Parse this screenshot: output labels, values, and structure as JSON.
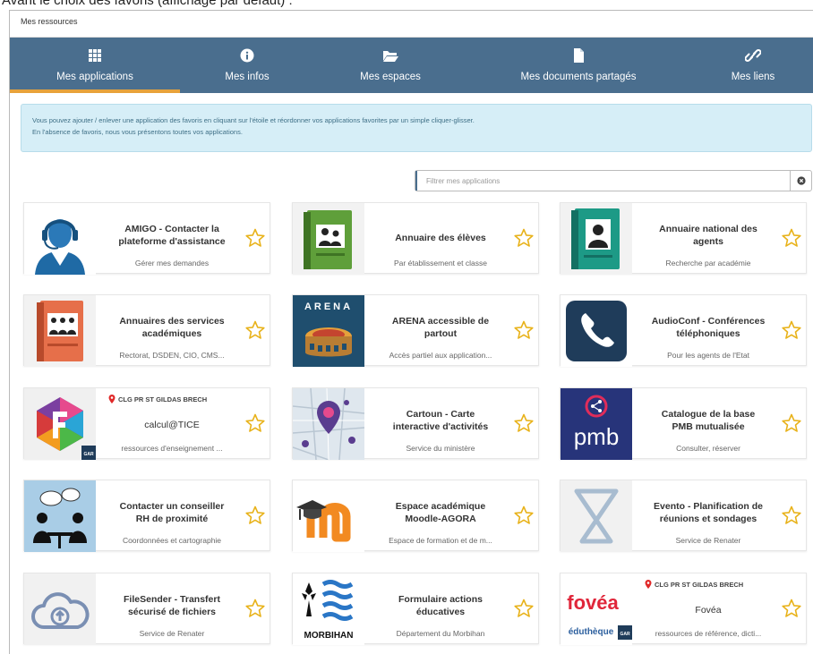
{
  "caption": "Avant le choix des favoris (affichage par défaut) :",
  "panel": {
    "title": "Mes ressources"
  },
  "tabs": [
    {
      "label": "Mes applications",
      "icon": "grid-icon",
      "active": true
    },
    {
      "label": "Mes infos",
      "icon": "info-icon",
      "active": false
    },
    {
      "label": "Mes espaces",
      "icon": "folder-open-icon",
      "active": false
    },
    {
      "label": "Mes documents partagés",
      "icon": "document-icon",
      "active": false
    },
    {
      "label": "Mes liens",
      "icon": "link-icon",
      "active": false
    }
  ],
  "info": {
    "line1": "Vous pouvez ajouter / enlever une application des favoris en cliquant sur l'étoile et réordonner vos applications favorites par un simple cliquer-glisser.",
    "line2": "En l'absence de favoris, nous vous présentons toutes vos applications."
  },
  "filter": {
    "placeholder": "Filtrer mes applications",
    "value": ""
  },
  "colors": {
    "tabbar": "#4a6e8e",
    "tab_active_underline": "#e8a23a",
    "info_bg": "#d6eef7",
    "star": "#e8b21a"
  },
  "apps": [
    {
      "title_l1": "AMIGO - Contacter la",
      "title_l2": "plateforme d'assistance",
      "desc": "Gérer mes demandes",
      "thumb": "headset-agent-icon"
    },
    {
      "title_l1": "Annuaire des élèves",
      "title_l2": "",
      "desc": "Par établissement et classe",
      "thumb": "green-directory-book-icon"
    },
    {
      "title_l1": "Annuaire national des",
      "title_l2": "agents",
      "desc": "Recherche par académie",
      "thumb": "teal-directory-book-icon"
    },
    {
      "title_l1": "Annuaires des services",
      "title_l2": "académiques",
      "desc": "Rectorat, DSDEN, CIO, CMS...",
      "thumb": "orange-directory-book-icon"
    },
    {
      "title_l1": "ARENA accessible de",
      "title_l2": "partout",
      "desc": "Accès partiel aux application...",
      "thumb": "arena-colosseum-icon",
      "thumb_text": "ARENA"
    },
    {
      "title_l1": "AudioConf - Conférences",
      "title_l2": "téléphoniques",
      "desc": "Pour les agents de l'Etat",
      "thumb": "phone-icon"
    },
    {
      "title_l1": "calcul@TICE",
      "title_l2": "",
      "desc": "ressources d'enseignement ...",
      "thumb": "calcul-tice-logo",
      "location": "CLG PR ST GILDAS BRECH",
      "thumb_badge": "GAR"
    },
    {
      "title_l1": "Cartoun - Carte",
      "title_l2": "interactive d'activités",
      "desc": "Service du ministère",
      "thumb": "map-pin-icon"
    },
    {
      "title_l1": "Catalogue de la base",
      "title_l2": "PMB mutualisée",
      "desc": "Consulter, réserver",
      "thumb": "pmb-share-logo",
      "thumb_text": "pmb"
    },
    {
      "title_l1": "Contacter un conseiller",
      "title_l2": "RH de proximité",
      "desc": "Coordonnées et cartographie",
      "thumb": "conversation-people-icon"
    },
    {
      "title_l1": "Espace académique",
      "title_l2": "Moodle-AGORA",
      "desc": "Espace de formation et de m...",
      "thumb": "moodle-logo"
    },
    {
      "title_l1": "Evento - Planification de",
      "title_l2": "réunions et sondages",
      "desc": "Service de Renater",
      "thumb": "hourglass-icon"
    },
    {
      "title_l1": "FileSender - Transfert",
      "title_l2": "sécurisé de fichiers",
      "desc": "Service de Renater",
      "thumb": "cloud-upload-icon"
    },
    {
      "title_l1": "Formulaire actions",
      "title_l2": "éducatives",
      "desc": "Département du Morbihan",
      "thumb": "morbihan-logo",
      "thumb_text": "MORBIHAN"
    },
    {
      "title_l1": "Fovéa",
      "title_l2": "",
      "desc": "ressources de référence, dicti...",
      "thumb": "fovea-logo",
      "location": "CLG PR ST GILDAS BRECH",
      "thumb_text": "fovéa",
      "thumb_text2": "éduthèque",
      "thumb_badge": "GAR"
    }
  ]
}
